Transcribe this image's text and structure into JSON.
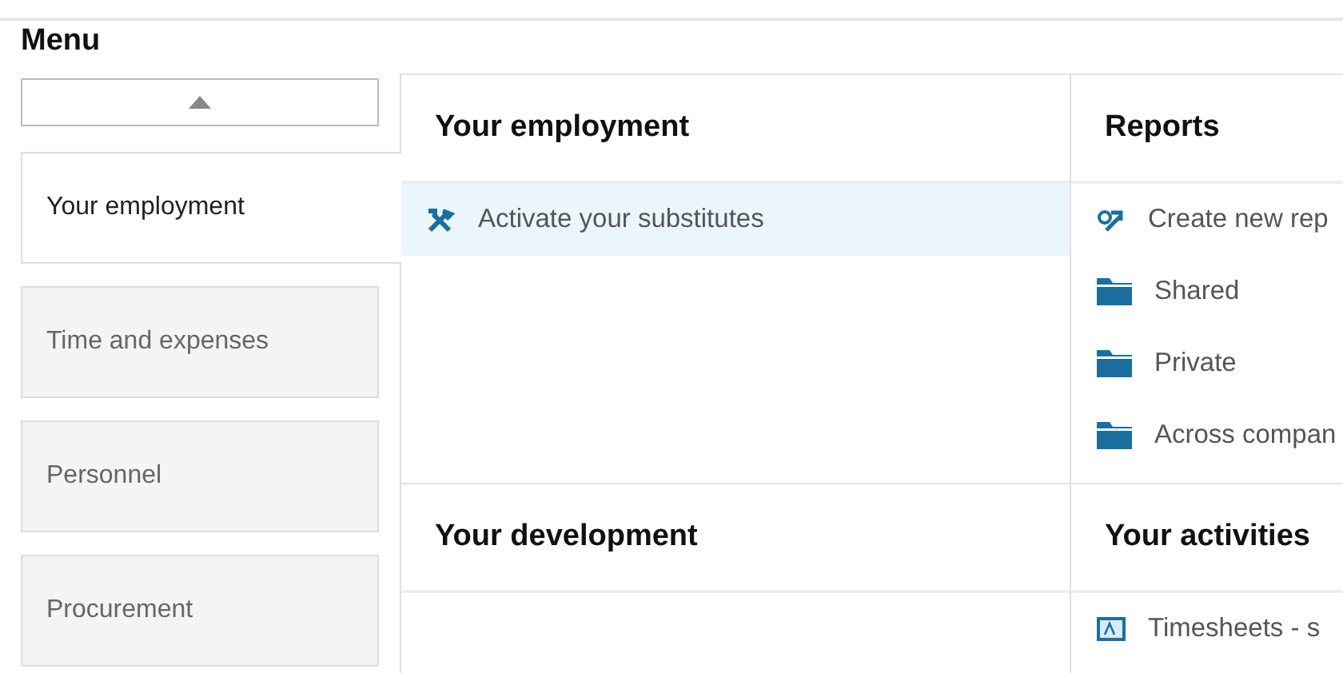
{
  "menu": {
    "title": "Menu",
    "tabs": [
      {
        "label": "Your employment",
        "selected": true
      },
      {
        "label": "Time and expenses",
        "selected": false
      },
      {
        "label": "Personnel",
        "selected": false
      },
      {
        "label": "Procurement",
        "selected": false
      }
    ]
  },
  "sections": [
    {
      "title": "Your employment",
      "items": [
        {
          "kind": "tool",
          "label": "Activate your substitutes",
          "highlighted": true
        }
      ]
    },
    {
      "title": "Reports",
      "items": [
        {
          "kind": "report",
          "label": "Create new rep",
          "highlighted": false
        },
        {
          "kind": "folder",
          "label": "Shared",
          "highlighted": false
        },
        {
          "kind": "folder",
          "label": "Private",
          "highlighted": false
        },
        {
          "kind": "folder",
          "label": "Across compan",
          "highlighted": false
        }
      ]
    },
    {
      "title": "Your development"
    },
    {
      "title": "Your activities",
      "items": [
        {
          "kind": "timesheet",
          "label": "Timesheets - s",
          "highlighted": false
        }
      ]
    }
  ]
}
